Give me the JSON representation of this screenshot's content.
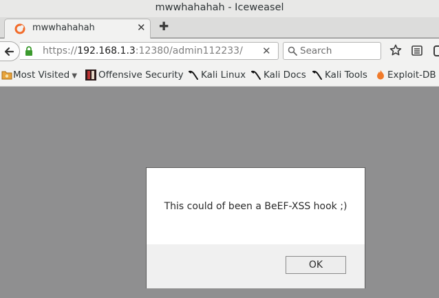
{
  "window": {
    "title": "mwwhahahah - Iceweasel"
  },
  "tab": {
    "label": "mwwhahahah",
    "close_glyph": "✕",
    "favicon": "iceweasel-icon"
  },
  "newtab_glyph": "✚",
  "nav": {
    "url_prefix": "https://",
    "url_host": "192.168.1.3",
    "url_rest": ":12380/admin112233/",
    "clear_glyph": "✕",
    "search_placeholder": "Search"
  },
  "bookmarks": [
    {
      "label": "Most Visited",
      "icon": "folder-icon"
    },
    {
      "label": "Offensive Security",
      "icon": "offsec-icon"
    },
    {
      "label": "Kali Linux",
      "icon": "kali-dragon-icon"
    },
    {
      "label": "Kali Docs",
      "icon": "kali-dragon-icon"
    },
    {
      "label": "Kali Tools",
      "icon": "kali-dragon-icon"
    },
    {
      "label": "Exploit-DB",
      "icon": "exploitdb-icon"
    }
  ],
  "dialog": {
    "message": "This could of been a BeEF-XSS hook ;)",
    "ok_label": "OK"
  },
  "colors": {
    "content_bg": "#8f8f90",
    "lock_green": "#3c9a2e",
    "iceweasel_orange": "#f26b2a"
  }
}
